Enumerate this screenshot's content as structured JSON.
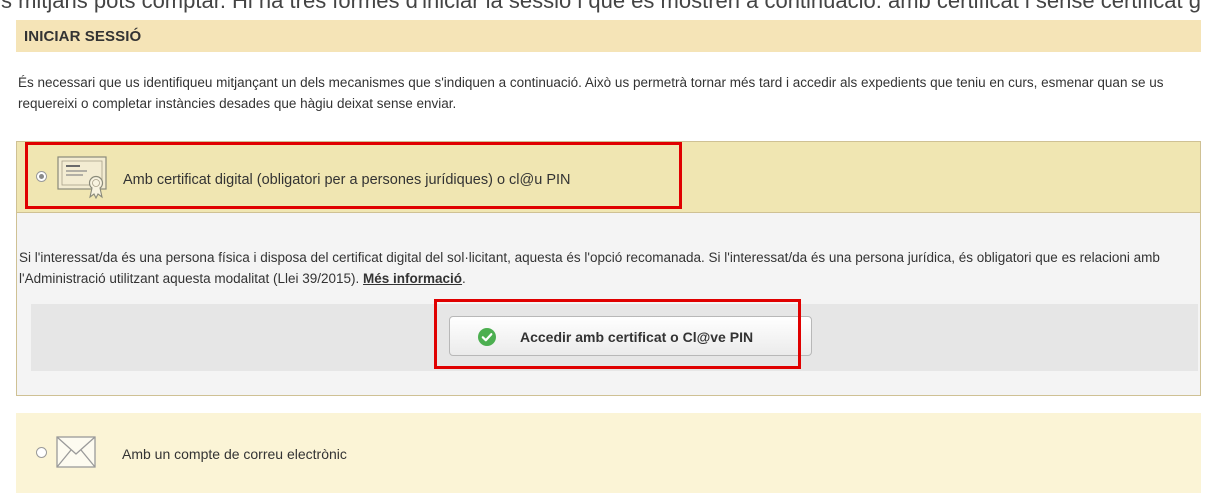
{
  "top_strip_text": "s fer-ho de tres maneres segons el perfil de la persona que la realitzi. A continuació t'expliquem com pots fer-ho i amb quins mitjans pots comptar. Hi ha tres formes d'iniciar la sessió i que es mostren a continuació: amb certificat i sense certificat g",
  "header": {
    "title": "INICIAR SESSIÓ"
  },
  "intro": "És necessari que us identifiqueu mitjançant un dels mecanismes que s'indiquen a continuació. Això us permetrà tornar més tard i accedir als expedients que teniu en curs, esmenar quan se us requereixi o completar instàncies desades que hàgiu deixat sense enviar.",
  "option_certificate": {
    "label": "Amb certificat digital (obligatori per a persones jurídiques) o cl@u PIN",
    "selected": true,
    "icon": "certificate-icon",
    "description": "Si l'interessat/da és una persona física i disposa del certificat digital del sol·licitant, aquesta és l'opció recomanada. Si l'interessat/da és una persona jurídica, és obligatori que es relacioni amb l'Administració utilitzant aquesta modalitat (Llei 39/2015). ",
    "more_link": "Més informació",
    "after_link": ".",
    "button_label": "Accedir amb certificat o Cl@ve PIN",
    "button_icon": "check-circle-icon"
  },
  "option_email": {
    "label": "Amb un compte de correu electrònic",
    "selected": false,
    "icon": "envelope-icon"
  },
  "colors": {
    "header_bg": "#f5e4b7",
    "option_selected_bg": "#f0e6b2",
    "option_unselected_bg": "#fbf4d6",
    "highlight_border": "#e00000",
    "check_green": "#4caf50"
  }
}
